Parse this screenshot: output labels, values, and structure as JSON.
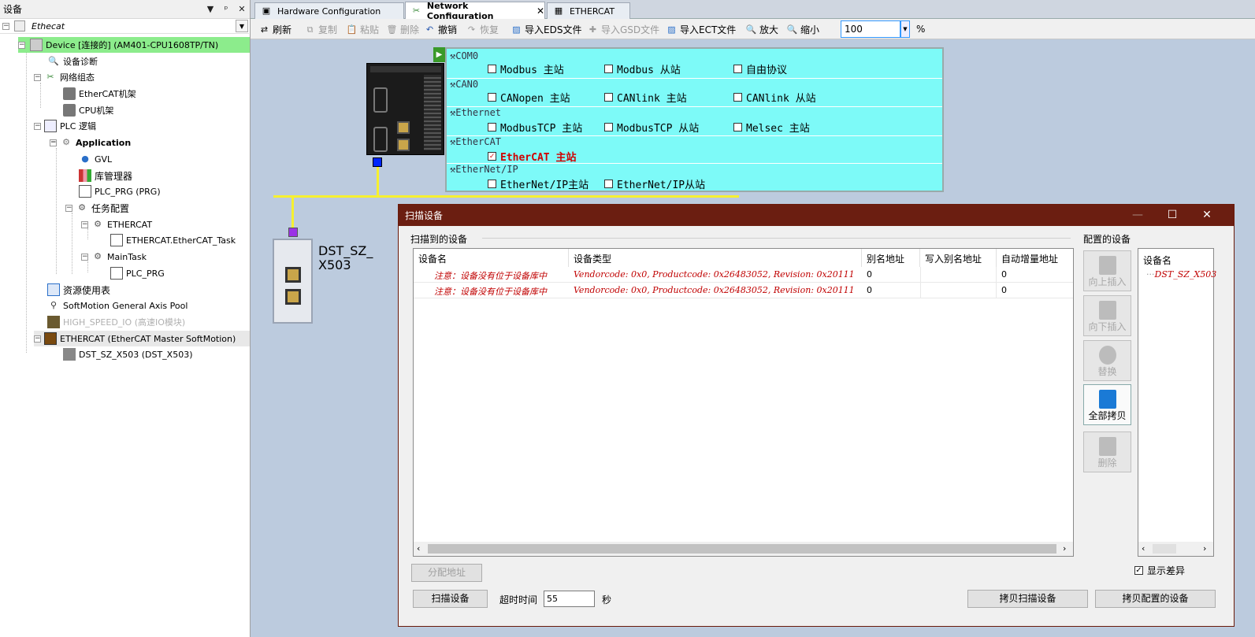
{
  "left_panel": {
    "title": "设备",
    "header_buttons": [
      "▼",
      "ᵖ",
      "✕"
    ],
    "combo_value": "Ethecat",
    "tree": [
      {
        "label": "Device [连接的] (AM401-CPU1608TP/TN)",
        "icon": "device-icon"
      },
      {
        "label": "设备诊断",
        "icon": "diagnose-icon"
      },
      {
        "label": "网络组态",
        "icon": "network-config-icon"
      },
      {
        "label": "EtherCAT机架",
        "icon": "rack-icon"
      },
      {
        "label": "CPU机架",
        "icon": "rack-icon"
      },
      {
        "label": "PLC 逻辑",
        "icon": "plc-logic-icon"
      },
      {
        "label": "Application",
        "icon": "application-icon"
      },
      {
        "label": "GVL",
        "icon": "globe-icon"
      },
      {
        "label": "库管理器",
        "icon": "library-icon"
      },
      {
        "label": "PLC_PRG (PRG)",
        "icon": "program-icon"
      },
      {
        "label": "任务配置",
        "icon": "task-config-icon"
      },
      {
        "label": "ETHERCAT",
        "icon": "task-icon"
      },
      {
        "label": "ETHERCAT.EtherCAT_Task",
        "icon": "program-icon"
      },
      {
        "label": "MainTask",
        "icon": "task-icon"
      },
      {
        "label": "PLC_PRG",
        "icon": "program-icon"
      },
      {
        "label": "资源使用表",
        "icon": "table-icon"
      },
      {
        "label": "SoftMotion General Axis Pool",
        "icon": "axis-icon"
      },
      {
        "label": "HIGH_SPEED_IO (高速IO模块)",
        "icon": "io-module-icon"
      },
      {
        "label": "ETHERCAT (EtherCAT Master SoftMotion)",
        "icon": "ethercat-master-icon"
      },
      {
        "label": "DST_SZ_X503 (DST_X503)",
        "icon": "slave-device-icon"
      }
    ]
  },
  "tabs": [
    {
      "label": "Hardware Configuration"
    },
    {
      "label": "Network Configuration",
      "close": "✕"
    },
    {
      "label": "ETHERCAT"
    }
  ],
  "toolbar": {
    "refresh": "刷新",
    "copy": "复制",
    "paste": "粘贴",
    "delete": "删除",
    "undo": "撤销",
    "redo": "恢复",
    "import_eds": "导入EDS文件",
    "import_gsd": "导入GSD文件",
    "import_ect": "导入ECT文件",
    "zoom_in": "放大",
    "zoom_out": "缩小",
    "zoom_value": "100",
    "zoom_unit": "%"
  },
  "protocols": {
    "com0": {
      "title": "COM0",
      "items": [
        {
          "label": "Modbus 主站",
          "checked": false
        },
        {
          "label": "Modbus 从站",
          "checked": false
        },
        {
          "label": "自由协议",
          "checked": false
        }
      ]
    },
    "can0": {
      "title": "CAN0",
      "items": [
        {
          "label": "CANopen 主站",
          "checked": false
        },
        {
          "label": "CANlink 主站",
          "checked": false
        },
        {
          "label": "CANlink 从站",
          "checked": false
        }
      ]
    },
    "ethernet": {
      "title": "Ethernet",
      "items": [
        {
          "label": "ModbusTCP 主站",
          "checked": false
        },
        {
          "label": "ModbusTCP 从站",
          "checked": false
        },
        {
          "label": "Melsec 主站",
          "checked": false
        }
      ]
    },
    "ethercat": {
      "title": "EtherCAT",
      "items": [
        {
          "label": "EtherCAT 主站",
          "checked": true
        }
      ]
    },
    "ethernetip": {
      "title": "EtherNet/IP",
      "items": [
        {
          "label": "EtherNet/IP主站",
          "checked": false
        },
        {
          "label": "EtherNet/IP从站",
          "checked": false
        }
      ]
    }
  },
  "slave_label_line1": "DST_SZ_",
  "slave_label_line2": "X503",
  "colors": {
    "dialog_title": "#6b1e11",
    "protocol_panel": "#7dfaf8",
    "bus_line": "#f6f030",
    "slave_connector": "#9b33e6",
    "plc_connector": "#0026ff",
    "warning": "#c00000",
    "tree_selected": "#8cec8c"
  },
  "dialog": {
    "title": "扫描设备",
    "scanned_group": "扫描到的设备",
    "configured_group": "配置的设备",
    "columns": [
      "设备名",
      "设备类型",
      "别名地址",
      "写入别名地址",
      "自动增量地址"
    ],
    "rows": [
      {
        "name": "注意：设备没有位于设备库中",
        "type": "Vendorcode: 0x0, Productcode: 0x26483052, Revision: 0x20111",
        "alias": "0",
        "write_alias": "",
        "auto_inc": "0"
      },
      {
        "name": "注意：设备没有位于设备库中",
        "type": "Vendorcode: 0x0, Productcode: 0x26483052, Revision: 0x20111",
        "alias": "0",
        "write_alias": "",
        "auto_inc": "0"
      }
    ],
    "side_buttons": {
      "insert_up": "向上插入",
      "insert_down": "向下插入",
      "replace": "替换",
      "copy_all": "全部拷贝",
      "delete": "删除"
    },
    "configured_column": "设备名",
    "configured_items": [
      "DST_SZ_X503"
    ],
    "assign_address": "分配地址",
    "show_diff": "显示差异",
    "scan_button": "扫描设备",
    "timeout_label": "超时时间",
    "timeout_value": "55",
    "timeout_unit": "秒",
    "copy_scanned": "拷贝扫描设备",
    "copy_configured": "拷贝配置的设备"
  }
}
